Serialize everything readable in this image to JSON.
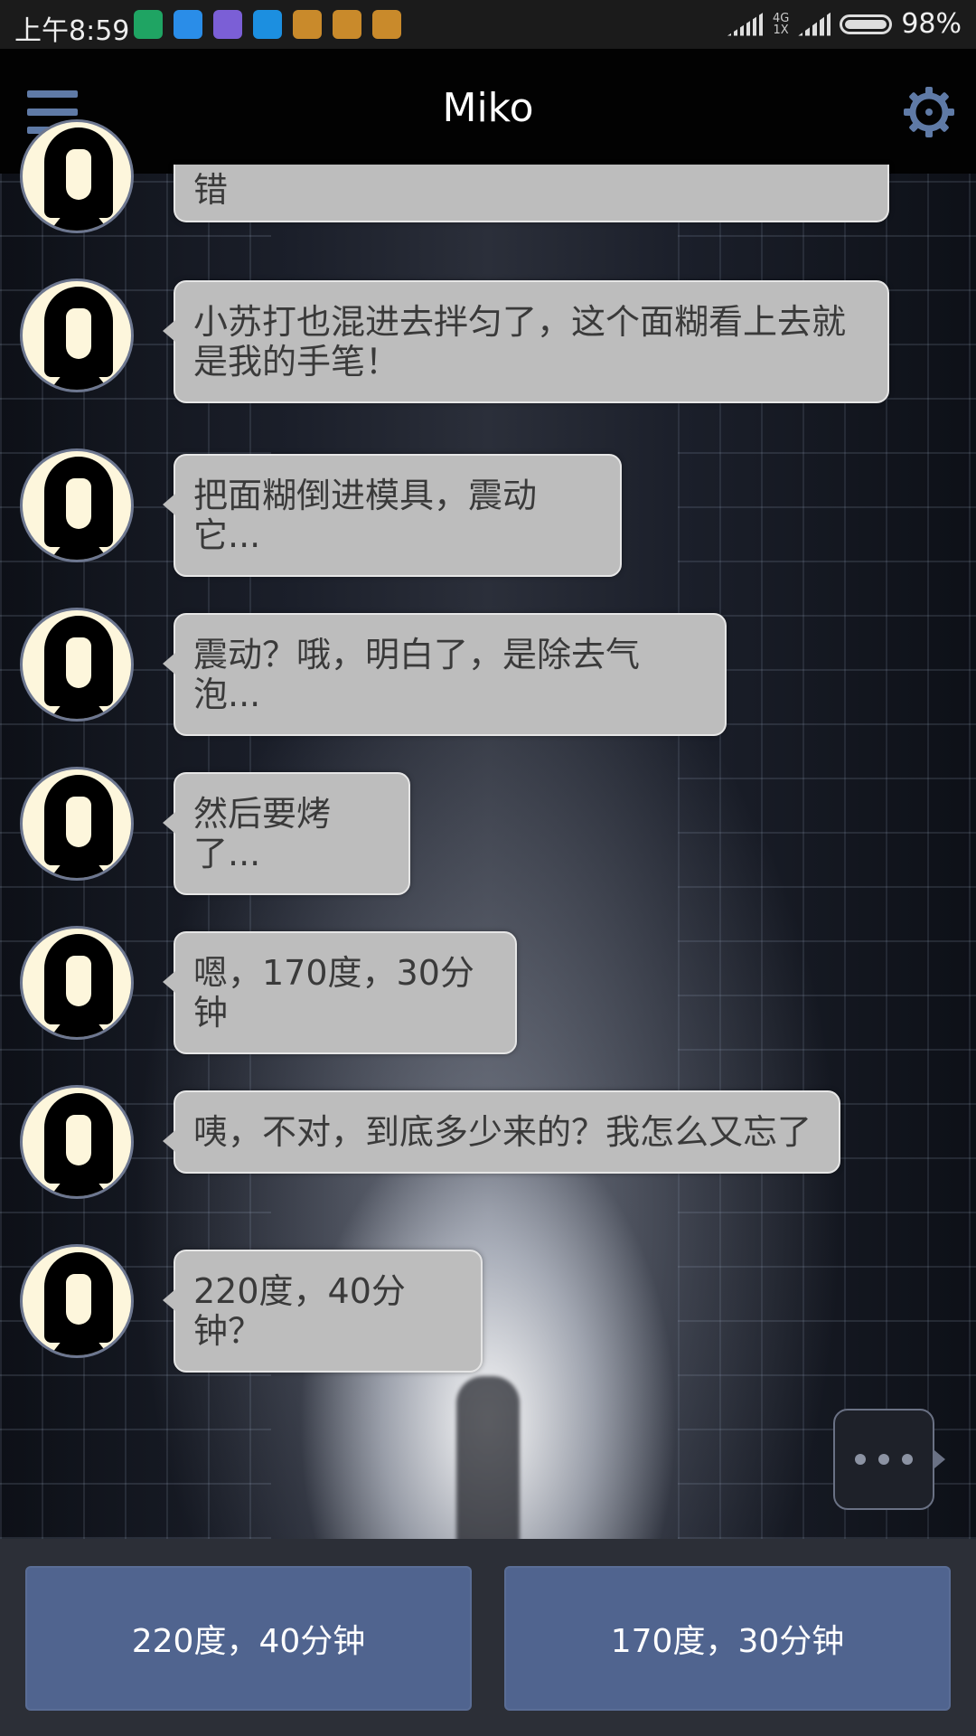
{
  "status_bar": {
    "time": "上午8:59",
    "network_label_top": "4G",
    "network_label_bottom": "1X",
    "battery": "98%",
    "app_icon_colors": [
      "#1fa463",
      "#2a8de8",
      "#7b5fd6",
      "#1c8fe0",
      "#c98a2b",
      "#c98a2b",
      "#c98a2b"
    ]
  },
  "header": {
    "title": "Miko",
    "menu_icon": "hamburger-icon",
    "settings_icon": "gear-icon",
    "accent_color": "#5f7aa6"
  },
  "messages": [
    {
      "text": "错"
    },
    {
      "text": "小苏打也混进去拌匀了，这个面糊看上去就是我的手笔！"
    },
    {
      "text": "把面糊倒进模具，震动它..."
    },
    {
      "text": "震动？哦，明白了，是除去气泡..."
    },
    {
      "text": "然后要烤了..."
    },
    {
      "text": "嗯，170度，30分钟"
    },
    {
      "text": "咦，不对，到底多少来的？我怎么又忘了"
    },
    {
      "text": "220度，40分钟？"
    }
  ],
  "choices": [
    {
      "label": "220度，40分钟"
    },
    {
      "label": "170度，30分钟"
    }
  ]
}
